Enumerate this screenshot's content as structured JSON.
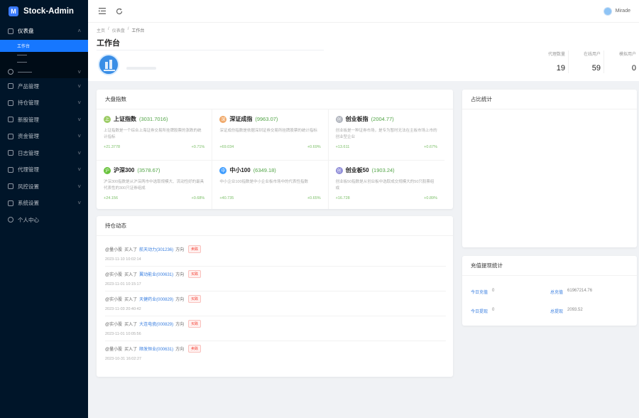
{
  "app": {
    "name": "Stock-Admin"
  },
  "sidebar": {
    "items": [
      {
        "label": "仪表盘",
        "open": true
      },
      {
        "label": "产品管理"
      },
      {
        "label": "持仓管理"
      },
      {
        "label": "新股管理"
      },
      {
        "label": "资金管理"
      },
      {
        "label": "日志管理"
      },
      {
        "label": "代理管理"
      },
      {
        "label": "风控设置"
      },
      {
        "label": "系统设置"
      },
      {
        "label": "个人中心"
      }
    ],
    "submenu": [
      {
        "label": "工作台",
        "active": true
      }
    ]
  },
  "header": {
    "username": "Mirade"
  },
  "page": {
    "breadcrumb": [
      "主页",
      "仪表盘",
      "工作台"
    ],
    "title": "工作台",
    "stats": [
      {
        "label": "代理数量",
        "value": "19"
      },
      {
        "label": "在线用户",
        "value": "59"
      },
      {
        "label": "模拟用户",
        "value": "0"
      }
    ]
  },
  "market": {
    "title": "大盘指数",
    "indices": [
      {
        "name": "上证指数",
        "value": "(3031.7016)",
        "badge": "上",
        "badge_color": "#9ccc65",
        "desc": "上证指数是一个综合上海证券交易所挂牌股票的涨跌的统计指标",
        "change": "+21.3778",
        "percent": "+0.71%"
      },
      {
        "name": "深证成指",
        "value": "(9963.07)",
        "badge": "深",
        "badge_color": "#f0a868",
        "desc": "深证成份指数是依据深圳证券交易所挂牌股票的统计指标",
        "change": "+69.034",
        "percent": "+0.69%"
      },
      {
        "name": "创业板指",
        "value": "(2004.77)",
        "badge": "创",
        "badge_color": "#b0b4bd",
        "desc": "创业板是一种证券市场，是专为暂时无法在主板市场上市的创业型企业",
        "change": "+13.611",
        "percent": "+0.67%"
      },
      {
        "name": "沪深300",
        "value": "(3578.67)",
        "badge": "沪",
        "badge_color": "#67c23a",
        "desc": "沪深300指数是从沪深两市中选取规模大、流动性好的最具代表性的300只证券组成",
        "change": "+24.156",
        "percent": "+0.68%"
      },
      {
        "name": "中小100",
        "value": "(6349.18)",
        "badge": "中",
        "badge_color": "#409eff",
        "desc": "中小企业100指数是中小企业板市场中的代表性指数",
        "change": "+40.735",
        "percent": "+0.65%"
      },
      {
        "name": "创业板50",
        "value": "(1903.24)",
        "badge": "创",
        "badge_color": "#8e8cd8",
        "desc": "创业板50指数是从创业板中选取成交规模大的50只股票组成",
        "change": "+16.728",
        "percent": "+0.89%"
      }
    ]
  },
  "trades": {
    "title": "持仓动态",
    "rows": [
      {
        "user": "@量小股",
        "action": "买入了",
        "stock": "航天动力(301236)",
        "dir": "方向",
        "badge": "卖跌",
        "time": "2023-11-10 10:02:14"
      },
      {
        "user": "@实小股",
        "action": "买入了",
        "stock": "翼动能业(000631)",
        "dir": "方向",
        "badge": "买跌",
        "time": "2023-11-01 10:15:17"
      },
      {
        "user": "@实小股",
        "action": "买入了",
        "stock": "天健药业(000829)",
        "dir": "方向",
        "badge": "买跌",
        "time": "2023-11-03 20:40:42"
      },
      {
        "user": "@实小股",
        "action": "买入了",
        "stock": "大连电瓷(000829)",
        "dir": "方向",
        "badge": "买跌",
        "time": "2023-11-01 10:05:56"
      },
      {
        "user": "@量小股",
        "action": "买入了",
        "stock": "顺发恒业(000631)",
        "dir": "方向",
        "badge": "卖跌",
        "time": "2023-10-31 16:02:27"
      }
    ]
  },
  "share": {
    "title": "占比统计"
  },
  "recharge": {
    "title": "充值提现统计",
    "cells": [
      {
        "label": "今日充值",
        "value": "0"
      },
      {
        "label": "总充值",
        "value": "61967214.76"
      },
      {
        "label": "今日提现",
        "value": "0"
      },
      {
        "label": "总提现",
        "value": "2093.52"
      }
    ]
  }
}
